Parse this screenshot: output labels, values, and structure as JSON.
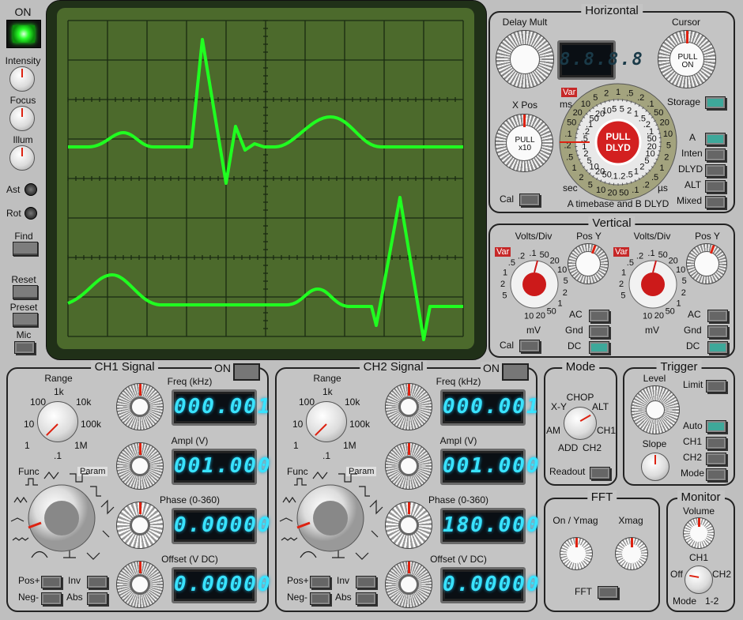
{
  "power": {
    "label": "ON"
  },
  "left": {
    "intensity": "Intensity",
    "focus": "Focus",
    "illum": "Illum",
    "ast": "Ast",
    "rot": "Rot",
    "find": "Find",
    "reset": "Reset",
    "preset": "Preset",
    "mic": "Mic"
  },
  "horizontal": {
    "title": "Horizontal",
    "delay_mult": "Delay Mult",
    "delay_display": "8.8.8.8",
    "cursor": "Cursor",
    "cursor_pull": "PULL",
    "cursor_on": "ON",
    "storage": "Storage",
    "xpos": "X Pos",
    "xpos_pull": "PULL",
    "xpos_x10": "x10",
    "cal": "Cal",
    "var": "Var",
    "ms": "ms",
    "sec": "sec",
    "us": "µs",
    "pull": "PULL",
    "dlyd": "DLYD",
    "caption": "A timebase and B DLYD",
    "modes": [
      "A",
      "Inten",
      "DLYD",
      "ALT",
      "Mixed"
    ],
    "dial_outer": [
      "1",
      ".5",
      ".2",
      ".1",
      "50",
      "20",
      "10",
      "5",
      "2",
      "1",
      ".5",
      ".2",
      ".1",
      "50",
      "20",
      "10",
      "5",
      "2",
      "1",
      ".5",
      ".2",
      ".1",
      "50",
      "20",
      "10",
      "5",
      "2"
    ],
    "dial_inner": [
      "5",
      "2",
      "1",
      ".5",
      ".2",
      ".1",
      "50",
      "20",
      "10",
      "5",
      "2",
      "1",
      ".5",
      ".2",
      ".1",
      "50",
      "20",
      "10",
      "5",
      "2",
      "1",
      ".5",
      ".2",
      ".1",
      "50",
      "20",
      "10",
      "5"
    ]
  },
  "vertical": {
    "title": "Vertical",
    "volts_div": "Volts/Div",
    "pos_y": "Pos Y",
    "var": "Var",
    "mv": "mV",
    "ac": "AC",
    "gnd": "Gnd",
    "dc": "DC",
    "cal": "Cal",
    "dial": [
      "5",
      "2",
      "1",
      ".5",
      ".2",
      ".1",
      "50",
      "20",
      "10",
      "5",
      "2",
      "1",
      "50",
      "20",
      "10"
    ]
  },
  "ch1": {
    "title": "CH1 Signal",
    "on": "ON",
    "range": "Range",
    "range_ticks": [
      "1",
      "10",
      "100",
      "1k",
      "10k",
      "100k",
      "1M",
      ".1"
    ],
    "func": "Func",
    "param": "Param",
    "freq_label": "Freq (kHz)",
    "freq": "000.001",
    "ampl_label": "Ampl (V)",
    "ampl": "001.000",
    "phase_label": "Phase (0-360)",
    "phase": "0.00000",
    "offset_label": "Offset (V DC)",
    "offset": "0.00000",
    "pos": "Pos+",
    "neg": "Neg-",
    "inv": "Inv",
    "abs": "Abs"
  },
  "ch2": {
    "title": "CH2 Signal",
    "on": "ON",
    "range": "Range",
    "range_ticks": [
      "1",
      "10",
      "100",
      "1k",
      "10k",
      "100k",
      "1M",
      ".1"
    ],
    "func": "Func",
    "param": "Param",
    "freq_label": "Freq (kHz)",
    "freq": "000.001",
    "ampl_label": "Ampl (V)",
    "ampl": "001.000",
    "phase_label": "Phase (0-360)",
    "phase": "180.000",
    "offset_label": "Offset (V DC)",
    "offset": "0.00000",
    "pos": "Pos+",
    "neg": "Neg-",
    "inv": "Inv",
    "abs": "Abs"
  },
  "mode": {
    "title": "Mode",
    "chop": "CHOP",
    "xy": "X-Y",
    "alt": "ALT",
    "am": "AM",
    "ch1": "CH1",
    "add": "ADD",
    "ch2": "CH2",
    "readout": "Readout"
  },
  "trigger": {
    "title": "Trigger",
    "level": "Level",
    "limit": "Limit",
    "slope": "Slope",
    "auto": "Auto",
    "ch1": "CH1",
    "ch2": "CH2",
    "mode": "Mode"
  },
  "fft": {
    "title": "FFT",
    "on_ymag": "On / Ymag",
    "xmag": "Xmag",
    "fft": "FFT"
  },
  "monitor": {
    "title": "Monitor",
    "volume": "Volume",
    "ch1": "CH1",
    "off": "Off",
    "ch2": "CH2",
    "mode": "Mode",
    "one_two": "1-2"
  },
  "colors": {
    "trace": "#20ff20",
    "screen": "#4c6a2c",
    "bezel": "#203018",
    "display_text": "#39e3ff",
    "accent_red": "#cc1a1a",
    "switch_on": "#3ea89a"
  }
}
